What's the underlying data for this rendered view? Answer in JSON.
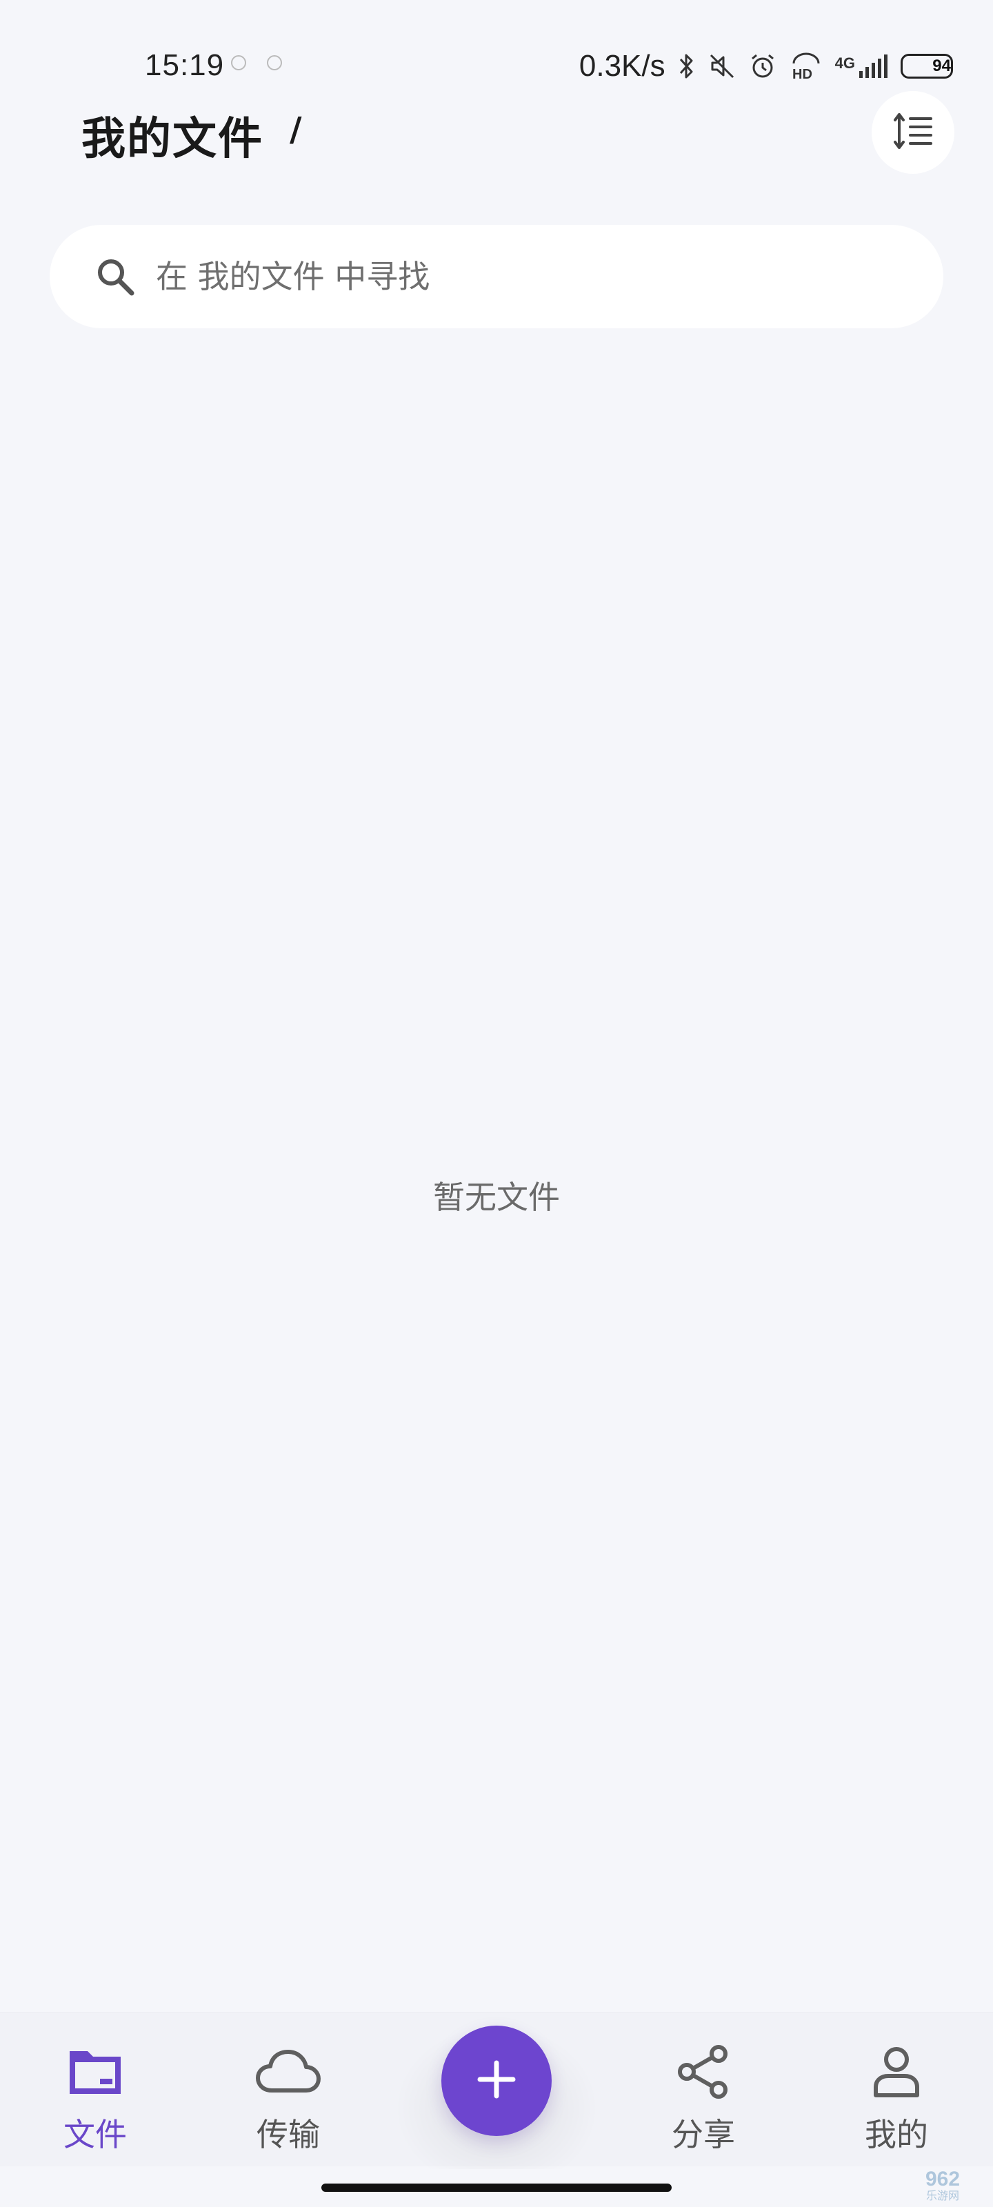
{
  "status_bar": {
    "time": "15:19",
    "net_speed": "0.3K/s",
    "signal_label": "4G",
    "battery_percent": "94",
    "battery_level": 0.94,
    "icons": [
      "bluetooth-icon",
      "mute-icon",
      "alarm-icon",
      "hd-icon",
      "signal-icon",
      "battery-icon"
    ]
  },
  "header": {
    "title": "我的文件",
    "path_separator": "/"
  },
  "search": {
    "placeholder": "在 我的文件 中寻找"
  },
  "main": {
    "empty_message": "暂无文件"
  },
  "bottom_nav": {
    "items": [
      {
        "label": "文件",
        "icon": "folder-icon",
        "active": true
      },
      {
        "label": "传输",
        "icon": "cloud-icon",
        "active": false
      },
      {
        "label": "分享",
        "icon": "share-icon",
        "active": false
      },
      {
        "label": "我的",
        "icon": "user-icon",
        "active": false
      }
    ],
    "fab_icon": "plus-icon"
  },
  "watermark": {
    "top": "962",
    "bottom": "乐游网"
  },
  "colors": {
    "accent": "#6d45cf",
    "active_label": "#6a47c9",
    "background": "#f5f6fa",
    "icon_gray": "#5f5f5f"
  }
}
